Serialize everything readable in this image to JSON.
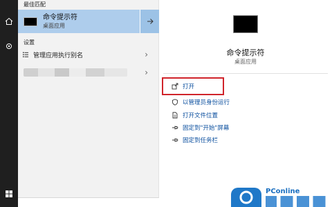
{
  "left_panel": {
    "best_match_label": "最佳匹配",
    "best_match": {
      "title": "命令提示符",
      "subtitle": "桌面应用"
    },
    "settings_label": "设置",
    "settings_items": [
      {
        "label": "管理应用执行别名"
      }
    ]
  },
  "detail": {
    "title": "命令提示符",
    "subtitle": "桌面应用",
    "actions": [
      {
        "label": "打开",
        "icon": "open-icon"
      },
      {
        "label": "以管理员身份运行",
        "icon": "shield-icon"
      },
      {
        "label": "打开文件位置",
        "icon": "file-location-icon"
      },
      {
        "label": "固定到\"开始\"屏幕",
        "icon": "pin-icon"
      },
      {
        "label": "固定到任务栏",
        "icon": "pin-icon"
      }
    ]
  },
  "watermark": {
    "brand": "PConline"
  },
  "colors": {
    "selection": "#aecdec",
    "action_link": "#0a4e9e",
    "highlight_box": "#d0232a"
  }
}
